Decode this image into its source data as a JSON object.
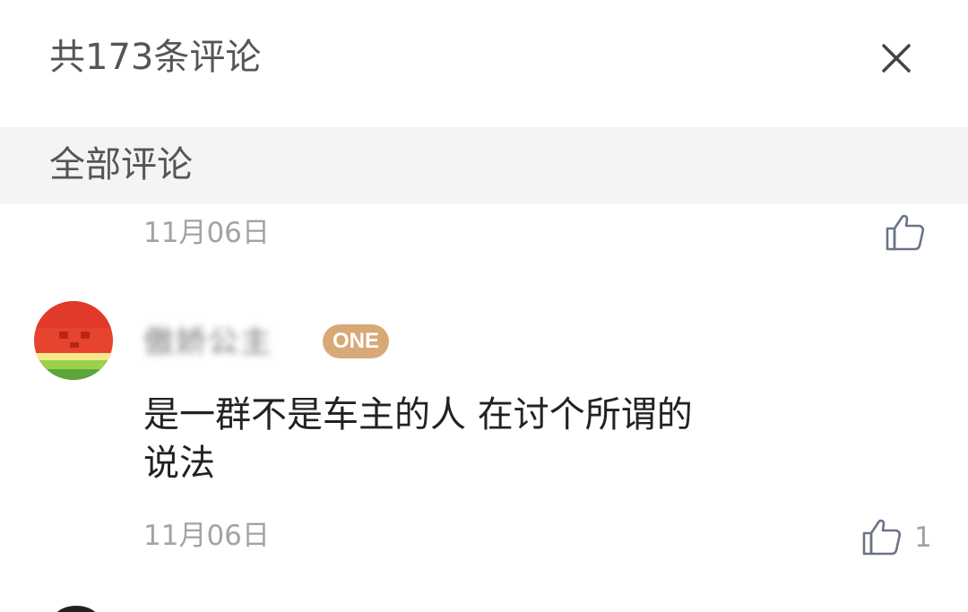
{
  "header": {
    "title": "共173条评论",
    "close_icon": "close-icon"
  },
  "section": {
    "title": "全部评论"
  },
  "comments": [
    {
      "date": "11月06日",
      "like_icon": "thumbs-up-icon",
      "like_count": ""
    },
    {
      "avatar_icon": "watermelon-avatar",
      "username": "傲娇公主",
      "badge": "ONE",
      "text_line1": "是一群不是车主的人 在讨个所谓的",
      "text_line2": "说法",
      "date": "11月06日",
      "like_icon": "thumbs-up-icon",
      "like_count": "1"
    }
  ],
  "colors": {
    "badge": "#d9a877",
    "section_bg": "#f4f4f4",
    "meta_text": "#a3a3a3",
    "icon_stroke": "#6b7388"
  }
}
